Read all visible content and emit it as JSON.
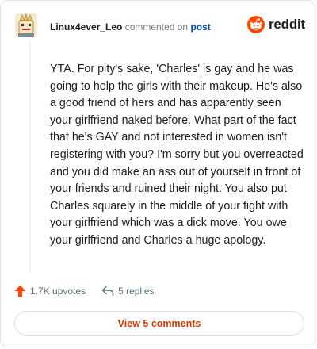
{
  "comment": {
    "username": "Linux4ever_Leo",
    "commented_on": "commented on",
    "post_link": "post",
    "body": "YTA. For pity's sake, 'Charles' is gay and he was going to help the girls with their makeup. He's also a good friend of hers and has apparently seen your girlfriend naked before. What part of the fact that he's GAY and not interested in women isn't registering with you? I'm sorry but you overreacted and you did make an ass out of yourself in front of your friends and ruined their night. You also put Charles squarely in the middle of your fight with your girlfriend which was a dick move. You owe your girlfriend and Charles a huge apology."
  },
  "brand": {
    "wordmark": "reddit",
    "color": "#ff4500"
  },
  "actions": {
    "upvotes": "1.7K upvotes",
    "replies": "5 replies",
    "upvote_icon": "upvote-arrow-icon",
    "reply_icon": "reply-icon"
  },
  "footer": {
    "view_comments": "View 5 comments",
    "accent": "#d93a00"
  }
}
